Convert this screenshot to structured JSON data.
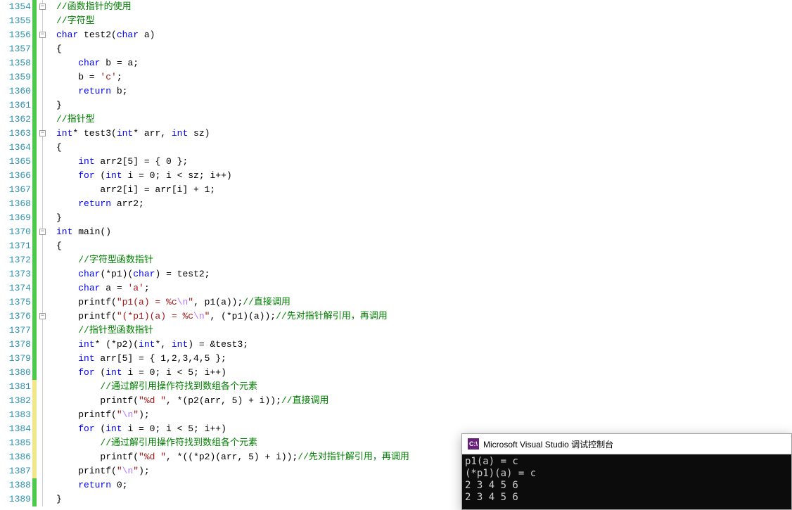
{
  "code_lines": [
    {
      "n": 1354,
      "fold": "minus",
      "bar": "green",
      "tokens": [
        {
          "t": "//函数指针的使用",
          "c": "c-comment"
        }
      ]
    },
    {
      "n": 1355,
      "bar": "green",
      "tokens": [
        {
          "t": "//字符型",
          "c": "c-comment"
        }
      ]
    },
    {
      "n": 1356,
      "fold": "minus",
      "bar": "green",
      "tokens": [
        {
          "t": "char",
          "c": "c-keyword"
        },
        {
          "t": " test2("
        },
        {
          "t": "char",
          "c": "c-keyword"
        },
        {
          "t": " a)"
        }
      ]
    },
    {
      "n": 1357,
      "bar": "green",
      "tokens": [
        {
          "t": "{"
        }
      ]
    },
    {
      "n": 1358,
      "bar": "green",
      "tokens": [
        {
          "t": "    "
        },
        {
          "t": "char",
          "c": "c-keyword"
        },
        {
          "t": " b = a;"
        }
      ]
    },
    {
      "n": 1359,
      "bar": "green",
      "tokens": [
        {
          "t": "    b = "
        },
        {
          "t": "'c'",
          "c": "c-str"
        },
        {
          "t": ";"
        }
      ]
    },
    {
      "n": 1360,
      "bar": "green",
      "tokens": [
        {
          "t": "    "
        },
        {
          "t": "return",
          "c": "c-keyword"
        },
        {
          "t": " b;"
        }
      ]
    },
    {
      "n": 1361,
      "bar": "green",
      "tokens": [
        {
          "t": "}"
        }
      ]
    },
    {
      "n": 1362,
      "bar": "green",
      "tokens": [
        {
          "t": "//指针型",
          "c": "c-comment"
        }
      ]
    },
    {
      "n": 1363,
      "fold": "minus",
      "bar": "green",
      "tokens": [
        {
          "t": "int",
          "c": "c-keyword"
        },
        {
          "t": "* test3("
        },
        {
          "t": "int",
          "c": "c-keyword"
        },
        {
          "t": "* arr, "
        },
        {
          "t": "int",
          "c": "c-keyword"
        },
        {
          "t": " sz)"
        }
      ]
    },
    {
      "n": 1364,
      "bar": "green",
      "tokens": [
        {
          "t": "{"
        }
      ]
    },
    {
      "n": 1365,
      "bar": "green",
      "tokens": [
        {
          "t": "    "
        },
        {
          "t": "int",
          "c": "c-keyword"
        },
        {
          "t": " arr2[5] = { 0 };"
        }
      ]
    },
    {
      "n": 1366,
      "bar": "green",
      "tokens": [
        {
          "t": "    "
        },
        {
          "t": "for",
          "c": "c-keyword"
        },
        {
          "t": " ("
        },
        {
          "t": "int",
          "c": "c-keyword"
        },
        {
          "t": " i = 0; i < sz; i++)"
        }
      ]
    },
    {
      "n": 1367,
      "bar": "green",
      "tokens": [
        {
          "t": "        arr2[i] = arr[i] + 1;"
        }
      ]
    },
    {
      "n": 1368,
      "bar": "green",
      "tokens": [
        {
          "t": "    "
        },
        {
          "t": "return",
          "c": "c-keyword"
        },
        {
          "t": " arr2;"
        }
      ]
    },
    {
      "n": 1369,
      "bar": "green",
      "tokens": [
        {
          "t": "}"
        }
      ]
    },
    {
      "n": 1370,
      "fold": "minus",
      "bar": "green",
      "tokens": [
        {
          "t": "int",
          "c": "c-keyword"
        },
        {
          "t": " main()"
        }
      ]
    },
    {
      "n": 1371,
      "bar": "green",
      "tokens": [
        {
          "t": "{"
        }
      ]
    },
    {
      "n": 1372,
      "bar": "green",
      "tokens": [
        {
          "t": "    "
        },
        {
          "t": "//字符型函数指针",
          "c": "c-comment"
        }
      ]
    },
    {
      "n": 1373,
      "bar": "green",
      "tokens": [
        {
          "t": "    "
        },
        {
          "t": "char",
          "c": "c-keyword"
        },
        {
          "t": "(*p1)("
        },
        {
          "t": "char",
          "c": "c-keyword"
        },
        {
          "t": ") = test2;"
        }
      ]
    },
    {
      "n": 1374,
      "bar": "green",
      "tokens": [
        {
          "t": "    "
        },
        {
          "t": "char",
          "c": "c-keyword"
        },
        {
          "t": " a = "
        },
        {
          "t": "'a'",
          "c": "c-str"
        },
        {
          "t": ";"
        }
      ]
    },
    {
      "n": 1375,
      "bar": "green",
      "tokens": [
        {
          "t": "    printf("
        },
        {
          "t": "\"p1(a) = %c",
          "c": "c-str"
        },
        {
          "t": "\\n",
          "c": "c-esc"
        },
        {
          "t": "\"",
          "c": "c-str"
        },
        {
          "t": ", p1(a));"
        },
        {
          "t": "//直接调用",
          "c": "c-comment"
        }
      ]
    },
    {
      "n": 1376,
      "fold": "minus",
      "bar": "green",
      "tokens": [
        {
          "t": "    printf("
        },
        {
          "t": "\"(*p1)(a) = %c",
          "c": "c-str"
        },
        {
          "t": "\\n",
          "c": "c-esc"
        },
        {
          "t": "\"",
          "c": "c-str"
        },
        {
          "t": ", (*p1)(a));"
        },
        {
          "t": "//先对指针解引用，再调用",
          "c": "c-comment"
        }
      ]
    },
    {
      "n": 1377,
      "bar": "green",
      "tokens": [
        {
          "t": "    "
        },
        {
          "t": "//指针型函数指针",
          "c": "c-comment"
        }
      ]
    },
    {
      "n": 1378,
      "bar": "green",
      "tokens": [
        {
          "t": "    "
        },
        {
          "t": "int",
          "c": "c-keyword"
        },
        {
          "t": "* (*p2)("
        },
        {
          "t": "int",
          "c": "c-keyword"
        },
        {
          "t": "*, "
        },
        {
          "t": "int",
          "c": "c-keyword"
        },
        {
          "t": ") = &test3;"
        }
      ]
    },
    {
      "n": 1379,
      "bar": "green",
      "tokens": [
        {
          "t": "    "
        },
        {
          "t": "int",
          "c": "c-keyword"
        },
        {
          "t": " arr[5] = { 1,2,3,4,5 };"
        }
      ]
    },
    {
      "n": 1380,
      "bar": "green",
      "tokens": [
        {
          "t": "    "
        },
        {
          "t": "for",
          "c": "c-keyword"
        },
        {
          "t": " ("
        },
        {
          "t": "int",
          "c": "c-keyword"
        },
        {
          "t": " i = 0; i < 5; i++)"
        }
      ]
    },
    {
      "n": 1381,
      "bar": "yellow",
      "tokens": [
        {
          "t": "        "
        },
        {
          "t": "//通过解引用操作符找到数组各个元素",
          "c": "c-comment"
        }
      ]
    },
    {
      "n": 1382,
      "bar": "yellow",
      "tokens": [
        {
          "t": "        printf("
        },
        {
          "t": "\"%d \"",
          "c": "c-str"
        },
        {
          "t": ", *(p2(arr, 5) + i));"
        },
        {
          "t": "//直接调用",
          "c": "c-comment"
        }
      ]
    },
    {
      "n": 1383,
      "bar": "yellow",
      "tokens": [
        {
          "t": "    printf("
        },
        {
          "t": "\"",
          "c": "c-str"
        },
        {
          "t": "\\n",
          "c": "c-esc"
        },
        {
          "t": "\"",
          "c": "c-str"
        },
        {
          "t": ");"
        }
      ]
    },
    {
      "n": 1384,
      "bar": "yellow",
      "tokens": [
        {
          "t": "    "
        },
        {
          "t": "for",
          "c": "c-keyword"
        },
        {
          "t": " ("
        },
        {
          "t": "int",
          "c": "c-keyword"
        },
        {
          "t": " i = 0; i < 5; i++)"
        }
      ]
    },
    {
      "n": 1385,
      "bar": "yellow",
      "tokens": [
        {
          "t": "        "
        },
        {
          "t": "//通过解引用操作符找到数组各个元素",
          "c": "c-comment"
        }
      ]
    },
    {
      "n": 1386,
      "bar": "yellow",
      "tokens": [
        {
          "t": "        printf("
        },
        {
          "t": "\"%d \"",
          "c": "c-str"
        },
        {
          "t": ", *((*p2)(arr, 5) + i));"
        },
        {
          "t": "//先对指针解引用，再调用",
          "c": "c-comment"
        }
      ]
    },
    {
      "n": 1387,
      "bar": "yellow",
      "tokens": [
        {
          "t": "    printf("
        },
        {
          "t": "\"",
          "c": "c-str"
        },
        {
          "t": "\\n",
          "c": "c-esc"
        },
        {
          "t": "\"",
          "c": "c-str"
        },
        {
          "t": ");"
        }
      ]
    },
    {
      "n": 1388,
      "bar": "green",
      "tokens": [
        {
          "t": "    "
        },
        {
          "t": "return",
          "c": "c-keyword"
        },
        {
          "t": " 0;"
        }
      ]
    },
    {
      "n": 1389,
      "bar": "green",
      "tokens": [
        {
          "t": "}"
        }
      ]
    }
  ],
  "console": {
    "icon_text": "C:\\",
    "title": "Microsoft Visual Studio 调试控制台",
    "lines": [
      "p1(a) = c",
      "(*p1)(a) = c",
      "2 3 4 5 6",
      "2 3 4 5 6"
    ]
  }
}
